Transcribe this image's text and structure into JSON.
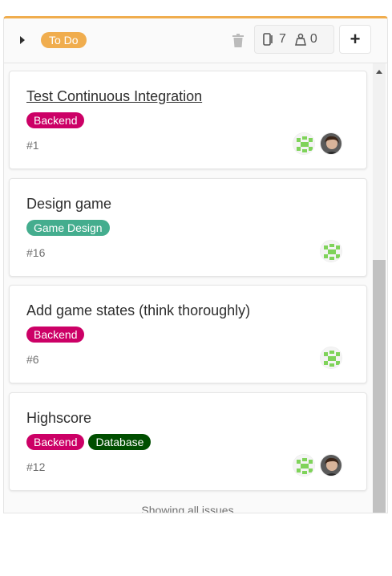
{
  "list": {
    "label": "To Do",
    "issue_count": "7",
    "weight": "0",
    "add_label": "+",
    "accent_color": "#f0ad4e"
  },
  "cards": [
    {
      "title": "Test Continuous Integration",
      "number": "#1",
      "labels": [
        {
          "text": "Backend",
          "color": "#cc0066"
        }
      ],
      "assignees": [
        "identicon",
        "user-photo"
      ]
    },
    {
      "title": "Design game",
      "number": "#16",
      "labels": [
        {
          "text": "Game Design",
          "color": "#44ad8e"
        }
      ],
      "assignees": [
        "identicon"
      ]
    },
    {
      "title": "Add game states (think thoroughly)",
      "number": "#6",
      "labels": [
        {
          "text": "Backend",
          "color": "#cc0066"
        }
      ],
      "assignees": [
        "identicon"
      ]
    },
    {
      "title": "Highscore",
      "number": "#12",
      "labels": [
        {
          "text": "Backend",
          "color": "#cc0066"
        },
        {
          "text": "Database",
          "color": "#004e00"
        }
      ],
      "assignees": [
        "identicon",
        "user-photo"
      ]
    }
  ],
  "footer": "Showing all issues"
}
